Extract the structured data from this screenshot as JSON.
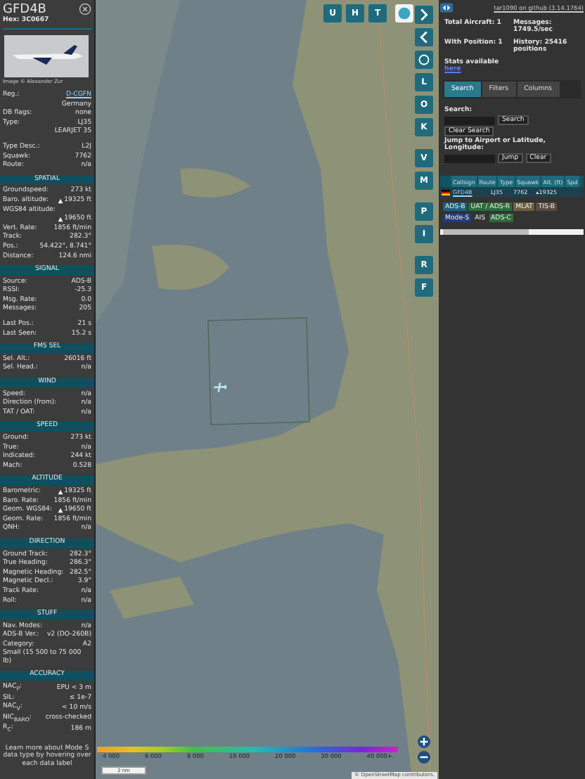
{
  "detail": {
    "callsign": "GFD4B",
    "hex_label": "Hex:",
    "hex": "3C0667",
    "photo_credit": "Image © Alexander Zur",
    "info": [
      {
        "kind": "pair",
        "label": "Reg.:",
        "value": "D-CGFN",
        "link": true
      },
      {
        "kind": "pair",
        "value": "Germany"
      },
      {
        "kind": "pair",
        "label": "DB flags:",
        "value": "none"
      },
      {
        "kind": "pair",
        "label": "Type:",
        "value": "LJ35"
      },
      {
        "kind": "pair",
        "value": "LEARJET 35"
      },
      {
        "kind": "gap"
      },
      {
        "kind": "pair",
        "label": "Type Desc.:",
        "value": "L2J"
      },
      {
        "kind": "pair",
        "label": "Squawk:",
        "value": "7762"
      },
      {
        "kind": "pair",
        "label": "Route:",
        "value": "n/a"
      }
    ],
    "sections": [
      {
        "title": "SPATIAL",
        "rows": [
          {
            "kind": "pair",
            "label": "Groundspeed:",
            "value": "273 kt"
          },
          {
            "kind": "pair",
            "label": "Baro. altitude:",
            "value": "19325 ft",
            "climbing": true
          },
          {
            "kind": "pair",
            "label": "WGS84 altitude:"
          },
          {
            "kind": "pair",
            "value": "19650 ft",
            "climbing": true
          },
          {
            "kind": "pair",
            "label": "Vert. Rate:",
            "value": "1856 ft/min"
          },
          {
            "kind": "pair",
            "label": "Track:",
            "value": "282.3°"
          },
          {
            "kind": "pair",
            "label": "Pos.:",
            "value": "54.422°, 8.741°"
          },
          {
            "kind": "pair",
            "label": "Distance:",
            "value": "124.6 nmi"
          }
        ]
      },
      {
        "title": "SIGNAL",
        "rows": [
          {
            "kind": "pair",
            "label": "Source:",
            "value": "ADS-B"
          },
          {
            "kind": "pair",
            "label": "RSSI:",
            "value": "-25.3"
          },
          {
            "kind": "pair",
            "label": "Msg. Rate:",
            "value": "0.0"
          },
          {
            "kind": "pair",
            "label": "Messages:",
            "value": "205"
          },
          {
            "kind": "gap"
          },
          {
            "kind": "pair",
            "label": "Last Pos.:",
            "value": "21 s"
          },
          {
            "kind": "pair",
            "label": "Last Seen:",
            "value": "15.2 s"
          }
        ]
      },
      {
        "title": "FMS SEL",
        "rows": [
          {
            "kind": "pair",
            "label": "Sel. Alt.:",
            "value": "26016 ft"
          },
          {
            "kind": "pair",
            "label": "Sel. Head.:",
            "value": "n/a"
          }
        ]
      },
      {
        "title": "WIND",
        "rows": [
          {
            "kind": "pair",
            "label": "Speed:",
            "value": "n/a"
          },
          {
            "kind": "pair",
            "label": "Direction (from):",
            "value": "n/a"
          },
          {
            "kind": "pair",
            "label": "TAT / OAT:",
            "value": "n/a"
          }
        ]
      },
      {
        "title": "SPEED",
        "rows": [
          {
            "kind": "pair",
            "label": "Ground:",
            "value": "273 kt"
          },
          {
            "kind": "pair",
            "label": "True:",
            "value": "n/a"
          },
          {
            "kind": "pair",
            "label": "Indicated:",
            "value": "244 kt"
          },
          {
            "kind": "pair",
            "label": "Mach:",
            "value": "0.528"
          }
        ]
      },
      {
        "title": "ALTITUDE",
        "rows": [
          {
            "kind": "pair",
            "label": "Barometric:",
            "value": "19325 ft",
            "climbing": true
          },
          {
            "kind": "pair",
            "label": "Baro. Rate:",
            "value": "1856 ft/min"
          },
          {
            "kind": "pair",
            "label": "Geom. WGS84:",
            "value": "19650 ft",
            "climbing": true
          },
          {
            "kind": "pair",
            "label": "Geom. Rate:",
            "value": "1856 ft/min"
          },
          {
            "kind": "pair",
            "label": "QNH:",
            "value": "n/a"
          }
        ]
      },
      {
        "title": "DIRECTION",
        "rows": [
          {
            "kind": "pair",
            "label": "Ground Track:",
            "value": "282.3°"
          },
          {
            "kind": "pair",
            "label": "True Heading:",
            "value": "286.3°"
          },
          {
            "kind": "pair",
            "label": "Magnetic Heading:",
            "value": "282.5°"
          },
          {
            "kind": "pair",
            "label": "Magnetic Decl.:",
            "value": "3.9°"
          },
          {
            "kind": "pair",
            "label": "Track Rate:",
            "value": "n/a"
          },
          {
            "kind": "pair",
            "label": "Roll:",
            "value": "n/a"
          }
        ]
      },
      {
        "title": "STUFF",
        "rows": [
          {
            "kind": "pair",
            "label": "Nav. Modes:",
            "value": "n/a"
          },
          {
            "kind": "pair",
            "label": "ADS-B Ver.:",
            "value": "v2 (DO-260B)"
          },
          {
            "kind": "pair",
            "label": "Category:",
            "value": "A2"
          },
          {
            "kind": "note",
            "label": "Small (15 500 to 75 000 lb)"
          }
        ]
      },
      {
        "title": "ACCURACY",
        "rows": [
          {
            "kind": "pair",
            "label": "NAC$_{P}$:",
            "value": "EPU < 3 m"
          },
          {
            "kind": "pair",
            "label": "SIL:",
            "value": "≤ 1e-7"
          },
          {
            "kind": "pair",
            "label": "NAC$_{V}$:",
            "value": "< 10 m/s"
          },
          {
            "kind": "pair",
            "label": "NIC$_{BARO}$:",
            "value": "cross-checked"
          },
          {
            "kind": "pair",
            "label": "R$_{C}$:",
            "value": "186 m"
          }
        ]
      }
    ],
    "footer": "Learn more about Mode S data type by hovering over each data label"
  },
  "map": {
    "top_buttons": [
      "U",
      "H",
      "T"
    ],
    "side_buttons": [
      {
        "kind": "next"
      },
      {
        "kind": "prev"
      },
      {
        "kind": "settings"
      },
      {
        "kind": "text",
        "label": "L"
      },
      {
        "kind": "text",
        "label": "O"
      },
      {
        "kind": "text",
        "label": "K"
      },
      {
        "kind": "gap"
      },
      {
        "kind": "text",
        "label": "V"
      },
      {
        "kind": "text",
        "label": "M"
      },
      {
        "kind": "gap"
      },
      {
        "kind": "text",
        "label": "P"
      },
      {
        "kind": "text",
        "label": "I"
      },
      {
        "kind": "gap"
      },
      {
        "kind": "text",
        "label": "R"
      },
      {
        "kind": "text",
        "label": "F"
      }
    ],
    "altitude_scale": [
      "4 000",
      "6 000",
      "8 000",
      "10 000",
      "20 000",
      "30 000",
      "40 000+"
    ],
    "distance_scale": "2 nm",
    "attribution": "© OpenStreetMap contributors."
  },
  "list": {
    "version_link": "tar1090 on github (3.14.1764)",
    "stats": [
      {
        "label": "Total Aircraft:",
        "value": "1"
      },
      {
        "label": "Messages:",
        "value": "1749.5/sec"
      },
      {
        "label": "With Position:",
        "value": "1"
      },
      {
        "label": "History:",
        "value": "25416 positions"
      }
    ],
    "stats_label": "Stats available",
    "stats_link": "here",
    "tabs": [
      {
        "label": "Search",
        "selected": true
      },
      {
        "label": "Filters",
        "selected": false
      },
      {
        "label": "Columns",
        "selected": false
      }
    ],
    "search_label": "Search:",
    "search_button": "Search",
    "clear_search_button": "Clear Search",
    "jump_label": "Jump to Airport or Latitude, Longitude:",
    "jump_button": "Jump",
    "clear_button": "Clear",
    "columns": [
      "Callsign",
      "Route",
      "Type",
      "Squawk",
      "Alt. (ft)",
      "Spd"
    ],
    "rows": [
      {
        "callsign": "GFD4B",
        "type": "LJ35",
        "squawk": "7762",
        "altitude": "19325",
        "climbing": true
      }
    ],
    "sources": [
      {
        "label": "ADS-B",
        "color": "#1f5f7a"
      },
      {
        "label": "UAT / ADS-R",
        "color": "#2f6a3a"
      },
      {
        "label": "MLAT",
        "color": "#6a6040"
      },
      {
        "label": "TIS-B",
        "color": "#5a4a40"
      },
      {
        "label": "Mode-S",
        "color": "#253a78"
      },
      {
        "label": "AIS",
        "color": "#333333"
      },
      {
        "label": "ADS-C",
        "color": "#2f6a3a"
      }
    ]
  }
}
